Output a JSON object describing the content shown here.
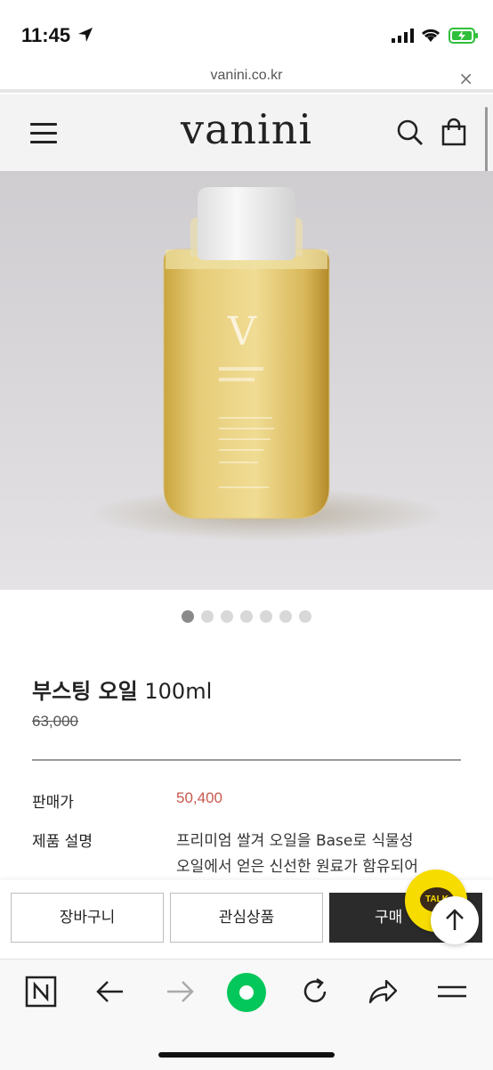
{
  "status_bar": {
    "time": "11:45"
  },
  "browser": {
    "url": "vanini.co.kr",
    "close_glyph": "×"
  },
  "site_header": {
    "logo": "vanini"
  },
  "product": {
    "image_dots_count": 7,
    "active_image_index": 0,
    "title_bold": "부스팅 오일",
    "title_rest": " 100ml",
    "original_price": "63,000",
    "sale_label": "판매가",
    "sale_price": "50,400",
    "description_label": "제품 설명",
    "description_lines": [
      "프리미엄 쌀겨 오일을 Base로 식물성",
      "오일에서 얻은 신선한 원료가 함유되어"
    ]
  },
  "actions": {
    "cart": "장바구니",
    "wishlist": "관심상품",
    "buy": "구매"
  },
  "kakao_label": "TALK",
  "colors": {
    "sale_price": "#c7594f",
    "buy_button": "#2b2b2b",
    "kakao": "#f7dc00",
    "naver_green": "#03c75a"
  },
  "icons": [
    "location-arrow-icon",
    "signal-icon",
    "wifi-icon",
    "battery-icon",
    "menu-icon",
    "search-icon",
    "cart-icon",
    "kakao-talk-icon",
    "scroll-top-icon",
    "naver-icon",
    "back-icon",
    "forward-icon",
    "green-dot-icon",
    "refresh-icon",
    "share-icon",
    "more-menu-icon"
  ]
}
